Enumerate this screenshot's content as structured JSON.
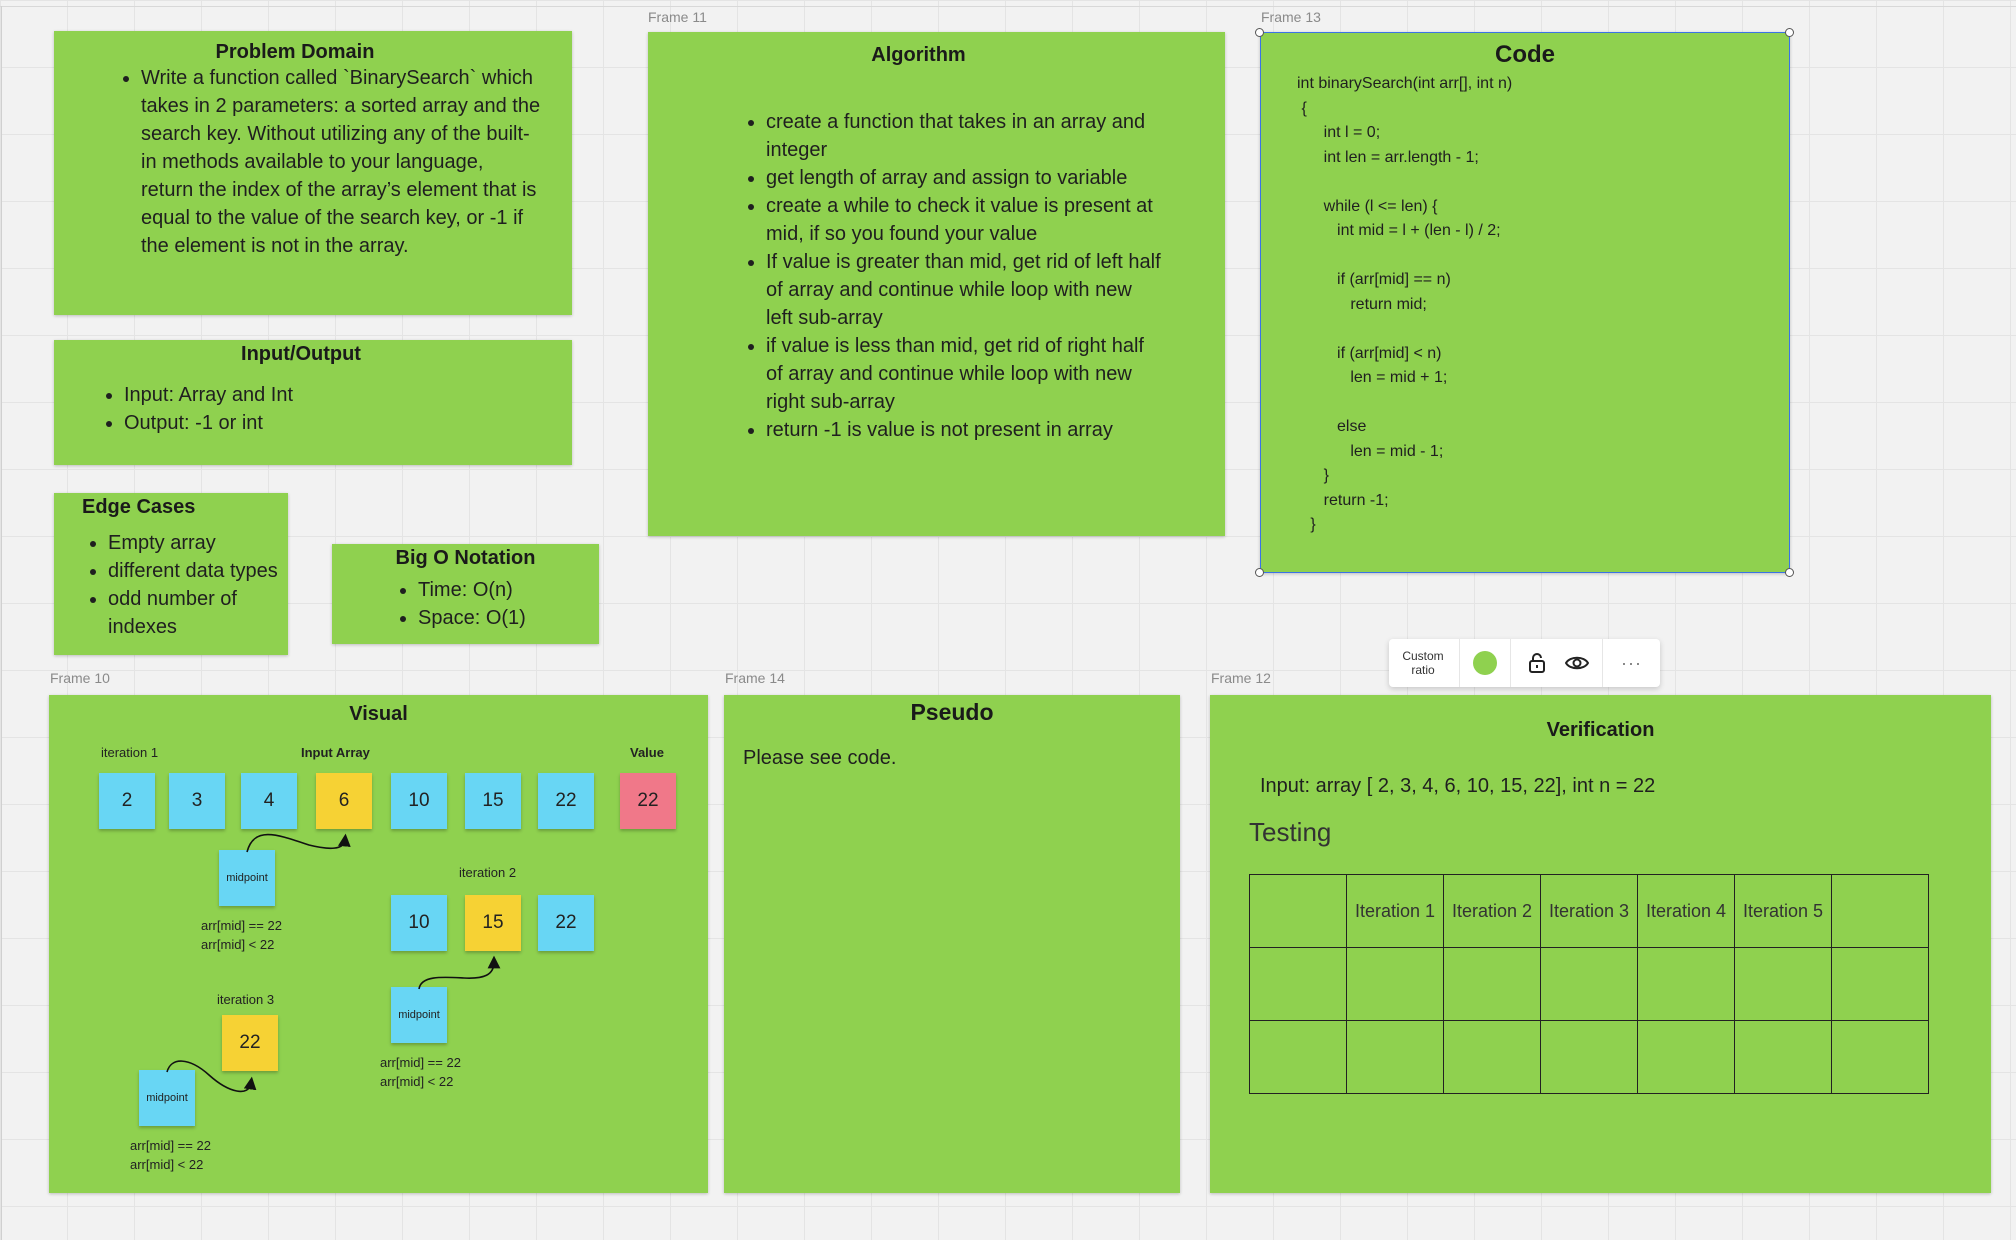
{
  "frames": {
    "f11": "Frame 11",
    "f13": "Frame 13",
    "f10": "Frame 10",
    "f14": "Frame 14",
    "f12": "Frame 12"
  },
  "problem_domain": {
    "title": "Problem Domain",
    "items": [
      "Write a function called `BinarySearch` which takes in 2 parameters: a sorted array and the search key. Without utilizing any of the built-in methods available to your language, return the index of the array’s element that is equal to the value of the search key, or -1 if the element is not in the array."
    ]
  },
  "input_output": {
    "title": "Input/Output",
    "items": [
      "Input: Array and Int",
      "Output: -1 or int"
    ]
  },
  "edge_cases": {
    "title": "Edge Cases",
    "items": [
      "Empty array",
      "different data types",
      "odd number of indexes"
    ]
  },
  "big_o": {
    "title": "Big O Notation",
    "items": [
      "Time: O(n)",
      "Space: O(1)"
    ]
  },
  "algorithm": {
    "title": "Algorithm",
    "items": [
      "create a function that takes in an array and integer",
      "get length of array and assign to variable",
      "create a while to check it value is present at mid, if so you found your value",
      "If value is greater than mid, get rid of left half of array and continue while loop with new left sub-array",
      "if value is less than mid, get rid of right half of array and continue while loop with new right sub-array",
      "return -1 is value is not present in array"
    ]
  },
  "code": {
    "title": "Code",
    "lines": [
      "int binarySearch(int arr[], int n)",
      " {",
      "      int l = 0;",
      "      int len = arr.length - 1;",
      "",
      "      while (l <= len) {",
      "         int mid = l + (len - l) / 2;",
      "",
      "         if (arr[mid] == n)",
      "            return mid;",
      "",
      "         if (arr[mid] < n)",
      "            len = mid + 1;",
      "",
      "         else",
      "            len = mid - 1;",
      "      }",
      "      return -1;",
      "   }"
    ]
  },
  "visual": {
    "title": "Visual",
    "iteration1_label": "iteration 1",
    "input_array_label": "Input Array",
    "value_label": "Value",
    "array": [
      "2",
      "3",
      "4",
      "6",
      "10",
      "15",
      "22"
    ],
    "value": "22",
    "iteration2_label": "iteration 2",
    "iteration2_array": [
      "10",
      "15",
      "22"
    ],
    "iteration3_label": "iteration 3",
    "iteration3_value": "22",
    "midpoint": "midpoint",
    "check_eq": "arr[mid] == 22",
    "check_lt": "arr[mid] < 22"
  },
  "pseudo": {
    "title": "Pseudo",
    "text": "Please see code."
  },
  "verification": {
    "title": "Verification",
    "input": "Input:  array [ 2, 3, 4, 6, 10, 15, 22], int n = 22",
    "testing": "Testing",
    "headers": [
      "",
      "Iteration 1",
      "Iteration 2",
      "Iteration 3",
      "Iteration 4",
      "Iteration 5",
      ""
    ]
  },
  "toolbar": {
    "custom_ratio": "Custom ratio",
    "color": "#8fd14f",
    "icons": [
      "lock-icon",
      "eye-icon",
      "more-icon"
    ]
  },
  "colors": {
    "sticky_green": "#8fd14f",
    "sticky_blue": "#68d6f4",
    "sticky_yellow": "#f6d234",
    "sticky_red": "#f07889",
    "selection": "#3b73e6"
  }
}
